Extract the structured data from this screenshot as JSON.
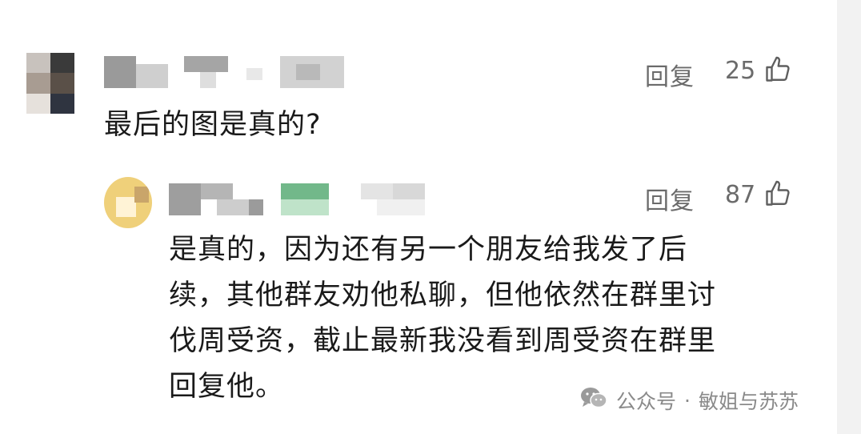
{
  "comments": [
    {
      "reply_label": "回复",
      "like_count": "25",
      "text": "最后的图是真的?"
    },
    {
      "reply_label": "回复",
      "like_count": "87",
      "text_lines": [
        "是真的，因为还有另一个朋友给我发了后",
        "续，其他群友劝他私聊，但他依然在群里讨",
        "伐周受资，截止最新我没看到周受资在群里",
        "回复他。"
      ]
    }
  ],
  "watermark": {
    "source": "公众号",
    "separator": "·",
    "account": "敏姐与苏苏"
  },
  "icons": {
    "like": "thumbs-up-icon",
    "wechat": "wechat-icon"
  },
  "colors": {
    "text": "#1a1a1a",
    "secondary": "#6b6b6b",
    "watermark": "#8a8a8a"
  }
}
